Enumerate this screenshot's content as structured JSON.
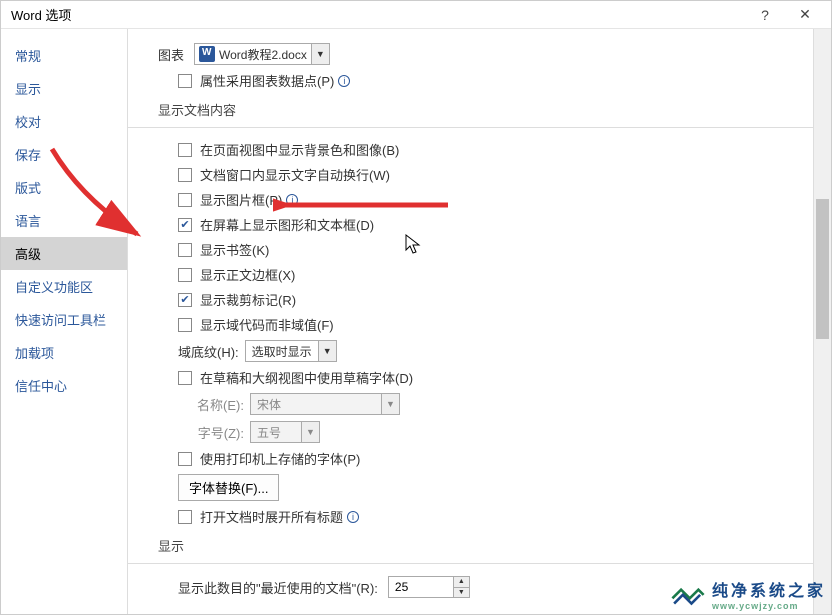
{
  "window": {
    "title": "Word 选项"
  },
  "sidebar": {
    "items": [
      {
        "label": "常规"
      },
      {
        "label": "显示"
      },
      {
        "label": "校对"
      },
      {
        "label": "保存"
      },
      {
        "label": "版式"
      },
      {
        "label": "语言"
      },
      {
        "label": "高级",
        "selected": true
      },
      {
        "label": "自定义功能区"
      },
      {
        "label": "快速访问工具栏"
      },
      {
        "label": "加载项"
      },
      {
        "label": "信任中心"
      }
    ]
  },
  "chart_row": {
    "label": "图表",
    "doc_name": "Word教程2.docx"
  },
  "chart_opts": {
    "use_datapoints": "属性采用图表数据点(P)"
  },
  "sec_doc": {
    "title": "显示文档内容"
  },
  "doc_opts": {
    "bg_image": "在页面视图中显示背景色和图像(B)",
    "wrap_in_window": "文档窗口内显示文字自动换行(W)",
    "pic_frame": "显示图片框(P)",
    "shapes_textbox": "在屏幕上显示图形和文本框(D)",
    "bookmarks": "显示书签(K)",
    "text_boundaries": "显示正文边框(X)",
    "crop_marks": "显示裁剪标记(R)",
    "field_codes": "显示域代码而非域值(F)"
  },
  "field_shading": {
    "label": "域底纹(H):",
    "value": "选取时显示"
  },
  "draft_font": {
    "label": "在草稿和大纲视图中使用草稿字体(D)",
    "name_label": "名称(E):",
    "name_value": "宋体",
    "size_label": "字号(Z):",
    "size_value": "五号"
  },
  "printer_fonts": "使用打印机上存储的字体(P)",
  "font_subst_btn": "字体替换(F)...",
  "expand_headings": "打开文档时展开所有标题",
  "sec_display": {
    "title": "显示"
  },
  "recent_docs": {
    "label": "显示此数目的\"最近使用的文档\"(R):",
    "value": "25"
  },
  "watermark": {
    "cn": "纯净系统之家",
    "en": "www.ycwjzy.com"
  }
}
